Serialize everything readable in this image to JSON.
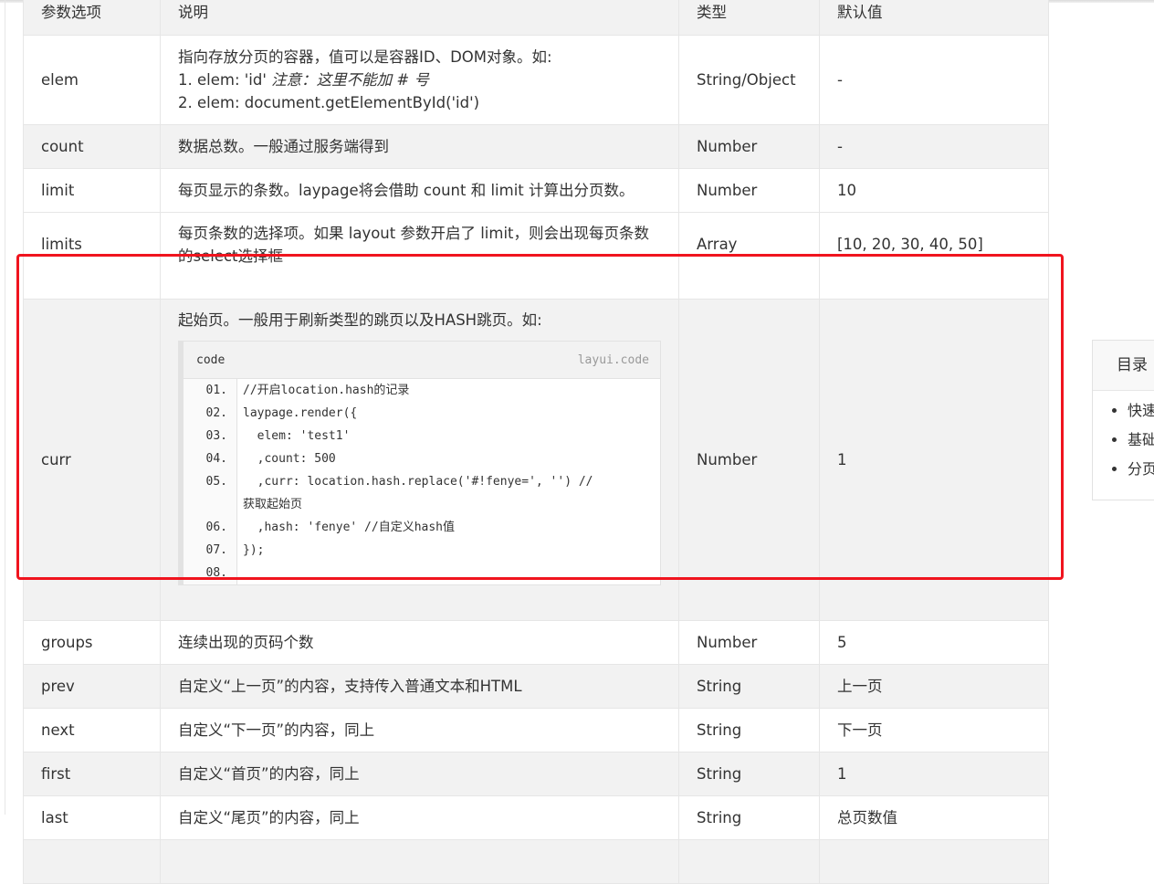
{
  "table": {
    "headers": [
      "参数选项",
      "说明",
      "类型",
      "默认值"
    ],
    "elem": {
      "name": "elem",
      "desc_line1": "指向存放分页的容器，值可以是容器ID、DOM对象。如:",
      "desc_line2a": "1. elem: 'id'",
      "desc_line2b": "注意：这里不能加 # 号",
      "desc_line3": "2. elem: document.getElementById('id')",
      "type": "String/Object",
      "default": "-"
    },
    "count": {
      "name": "count",
      "desc": "数据总数。一般通过服务端得到",
      "type": "Number",
      "default": "-"
    },
    "limit": {
      "name": "limit",
      "desc": "每页显示的条数。laypage将会借助 count 和 limit 计算出分页数。",
      "type": "Number",
      "default": "10"
    },
    "limits": {
      "name": "limits",
      "desc": "每页条数的选择项。如果 layout 参数开启了 limit，则会出现每页条数的select选择框",
      "type": "Array",
      "default": "[10, 20, 30, 40, 50]"
    },
    "curr": {
      "name": "curr",
      "desc": "起始页。一般用于刷新类型的跳页以及HASH跳页。如:",
      "type": "Number",
      "default": "1",
      "code": {
        "label": "code",
        "brand": "layui.code",
        "line_numbers": [
          "01.",
          "02.",
          "03.",
          "04.",
          "05.",
          "",
          "06.",
          "07.",
          "08."
        ],
        "lines": [
          "//开启location.hash的记录",
          "laypage.render({",
          "  elem: 'test1'",
          "  ,count: 500",
          "  ,curr: location.hash.replace('#!fenye=', '') //",
          "获取起始页",
          "  ,hash: 'fenye' //自定义hash值",
          "});",
          ""
        ]
      }
    },
    "groups": {
      "name": "groups",
      "desc": "连续出现的页码个数",
      "type": "Number",
      "default": "5"
    },
    "prev": {
      "name": "prev",
      "desc": "自定义“上一页”的内容，支持传入普通文本和HTML",
      "type": "String",
      "default": "上一页"
    },
    "next": {
      "name": "next",
      "desc": "自定义“下一页”的内容，同上",
      "type": "String",
      "default": "下一页"
    },
    "first": {
      "name": "first",
      "desc": "自定义“首页”的内容，同上",
      "type": "String",
      "default": "1"
    },
    "last": {
      "name": "last",
      "desc": "自定义“尾页”的内容，同上",
      "type": "String",
      "default": "总页数值"
    }
  },
  "toc": {
    "title": "目录",
    "items": [
      "快速",
      "基础",
      "分页"
    ]
  },
  "colors": {
    "highlight": "#f0141e",
    "header_bg": "#f2f2f2",
    "border": "#e6e6e6"
  }
}
